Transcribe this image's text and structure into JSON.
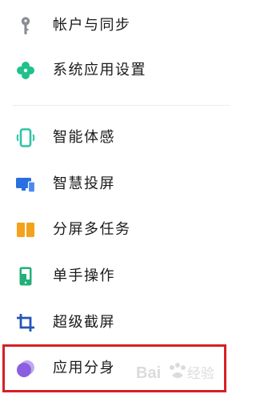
{
  "menu": {
    "items": [
      {
        "label": "帐户与同步",
        "icon": "key-icon",
        "color": "#8a8d93"
      },
      {
        "label": "系统应用设置",
        "icon": "clover-icon",
        "color": "#22c08a"
      },
      {
        "label": "智能体感",
        "icon": "phone-outline-icon",
        "color": "#2ec4a4"
      },
      {
        "label": "智慧投屏",
        "icon": "screen-cast-icon",
        "color": "#2a6fe0"
      },
      {
        "label": "分屏多任务",
        "icon": "split-screen-icon",
        "color": "#f3a21b"
      },
      {
        "label": "单手操作",
        "icon": "one-hand-icon",
        "color": "#22b07a"
      },
      {
        "label": "超级截屏",
        "icon": "crop-icon",
        "color": "#2455b8"
      },
      {
        "label": "应用分身",
        "icon": "app-clone-icon",
        "color": "#8b5fe0"
      }
    ]
  },
  "highlight": {
    "color": "#d71f26"
  },
  "watermark": {
    "text": "Bai 经验"
  }
}
